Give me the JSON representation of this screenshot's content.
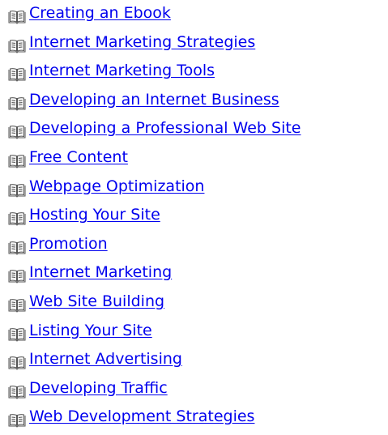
{
  "links": [
    {
      "label": "Creating an Ebook",
      "icon": "book-icon"
    },
    {
      "label": "Internet Marketing Strategies",
      "icon": "book-icon"
    },
    {
      "label": "Internet Marketing Tools",
      "icon": "book-icon"
    },
    {
      "label": "Developing an Internet Business",
      "icon": "book-icon"
    },
    {
      "label": "Developing a Professional Web Site",
      "icon": "book-icon"
    },
    {
      "label": "Free Content",
      "icon": "book-icon"
    },
    {
      "label": "Webpage Optimization",
      "icon": "book-icon"
    },
    {
      "label": "Hosting Your Site",
      "icon": "book-icon"
    },
    {
      "label": "Promotion",
      "icon": "book-icon"
    },
    {
      "label": "Internet Marketing",
      "icon": "book-icon"
    },
    {
      "label": "Web Site Building",
      "icon": "book-icon"
    },
    {
      "label": "Listing Your Site",
      "icon": "book-icon"
    },
    {
      "label": "Internet Advertising",
      "icon": "book-icon"
    },
    {
      "label": "Developing Traffic",
      "icon": "book-icon"
    },
    {
      "label": "Web Development Strategies",
      "icon": "book-icon"
    }
  ],
  "colors": {
    "link": "#0000ee",
    "background": "#ffffff",
    "icon_stroke": "#555555",
    "icon_fill": "#f4f4f4"
  }
}
